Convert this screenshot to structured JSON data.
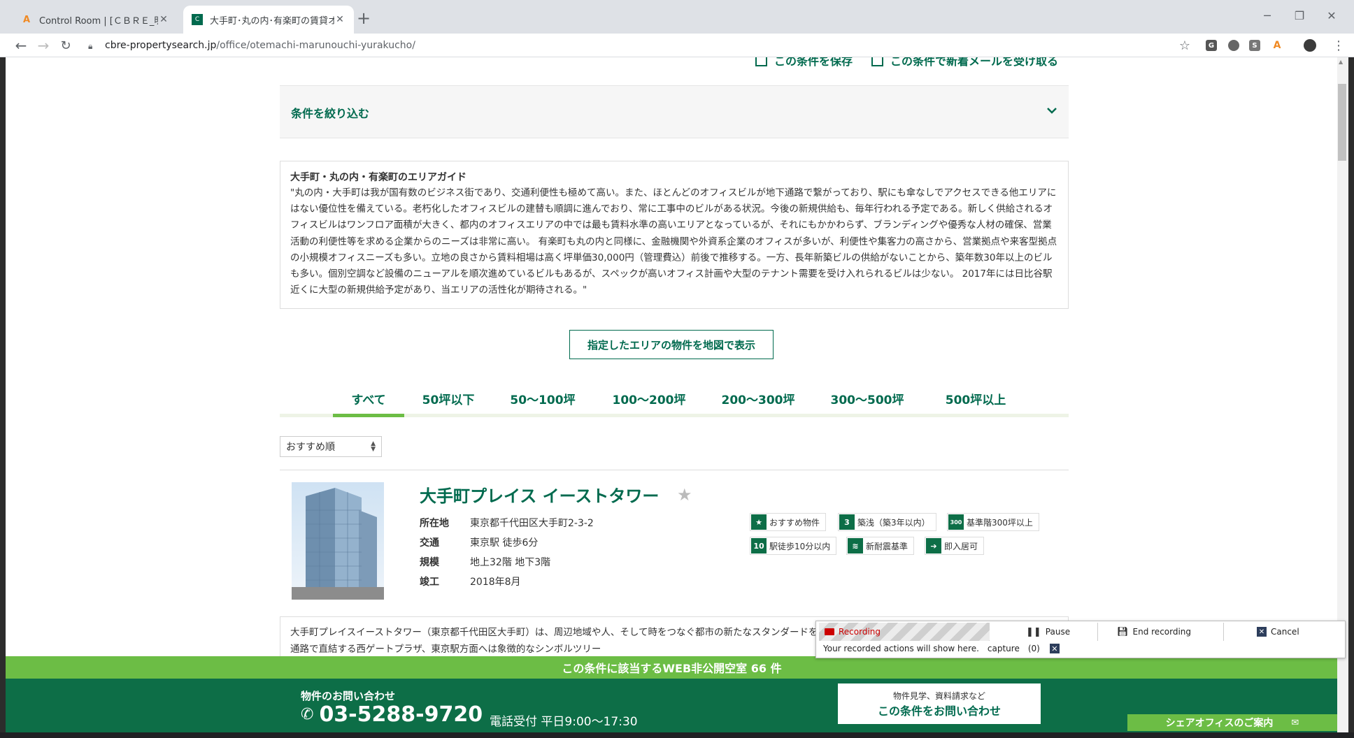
{
  "browser": {
    "tabs": [
      {
        "title": "Control Room | [ＣＢＲＥ_明細取",
        "favicon": "automation-anywhere-icon"
      },
      {
        "title": "大手町･丸の内･有楽町の賃貸オフ",
        "favicon": "cbre-icon"
      }
    ],
    "url_host": "cbre-propertysearch.jp",
    "url_path": "/office/otemachi-marunouchi-yurakucho/",
    "extensions": [
      "G",
      "S"
    ]
  },
  "page": {
    "save_condition": "この条件を保存",
    "save_mail": "この条件で新着メールを受け取る",
    "refine_label": "条件を絞り込む",
    "guide_title": "大手町・丸の内・有楽町のエリアガイド",
    "guide_text": "\"丸の内・大手町は我が国有数のビジネス街であり、交通利便性も極めて高い。また、ほとんどのオフィスビルが地下通路で繋がっており、駅にも傘なしでアクセスできる他エリアにはない優位性を備えている。老朽化したオフィスビルの建替も順調に進んでおり、常に工事中のビルがある状況。今後の新規供給も、毎年行われる予定である。新しく供給されるオフィスビルはワンフロア面積が大きく、都内のオフィスエリアの中では最も賃料水準の高いエリアとなっているが、それにもかかわらず、ブランディングや優秀な人材の確保、営業活動の利便性等を求める企業からのニーズは非常に高い。 有楽町も丸の内と同様に、金融機関や外資系企業のオフィスが多いが、利便性や集客力の高さから、営業拠点や来客型拠点の小規模オフィスニーズも多い。立地の良さから賃料相場は高く坪単価30,000円（管理費込）前後で推移する。一方、長年新築ビルの供給がないことから、築年数30年以上のビルも多い。個別空調など設備のニューアルを順次進めているビルもあるが、スペックが高いオフィス計画や大型のテナント需要を受け入れられるビルは少ない。 2017年には日比谷駅近くに大型の新規供給予定があり、当エリアの活性化が期待される。\"",
    "map_button": "指定したエリアの物件を地図で表示",
    "size_tabs": [
      "すべて",
      "50坪以下",
      "50〜100坪",
      "100〜200坪",
      "200〜300坪",
      "300〜500坪",
      "500坪以上"
    ],
    "sort_selected": "おすすめ順",
    "property": {
      "name": "大手町プレイス イーストタワー",
      "specs": [
        {
          "k": "所在地",
          "v": "東京都千代田区大手町2-3-2"
        },
        {
          "k": "交通",
          "v": "東京駅 徒歩6分"
        },
        {
          "k": "規模",
          "v": "地上32階 地下3階"
        },
        {
          "k": "竣工",
          "v": "2018年8月"
        }
      ],
      "badges": [
        {
          "icon": "star-icon",
          "glyph": "★",
          "label": "おすすめ物件"
        },
        {
          "icon": "new-building-icon",
          "glyph": "3",
          "label": "築浅（築3年以内）"
        },
        {
          "icon": "floor-300-icon",
          "glyph": "300",
          "label": "基準階300坪以上"
        },
        {
          "icon": "walk-10-icon",
          "glyph": "10",
          "label": "駅徒歩10分以内"
        },
        {
          "icon": "seismic-icon",
          "glyph": "≋",
          "label": "新耐震基準"
        },
        {
          "icon": "move-in-icon",
          "glyph": "➔",
          "label": "即入居可"
        }
      ],
      "description": "大手町プレイスイーストタワー（東京都千代田区大手町）は、周辺地域や人、そして時をつなぐ都市の新たなスタンダードを目指すオフィスタワー。東京メトロ「大手町駅」と地下通路で直結する西ゲートプラザ、東京駅方面へは象徴的なシンボルツリー"
    },
    "web_banner": "この条件に該当するWEB非公開空室 66 件",
    "contact": {
      "heading": "物件のお問い合わせ",
      "phone": "03-5288-9720",
      "hours": "電話受付 平日9:00〜17:30",
      "button_small": "物件見学、資料請求など",
      "button_big": "この条件をお問い合わせ"
    },
    "share_office": "シェアオフィスのご案内"
  },
  "recorder": {
    "status": "Recording",
    "pause": "Pause",
    "end": "End recording",
    "cancel": "Cancel",
    "message": "Your recorded actions will show here.",
    "capture": "capture",
    "count": "(0)"
  }
}
